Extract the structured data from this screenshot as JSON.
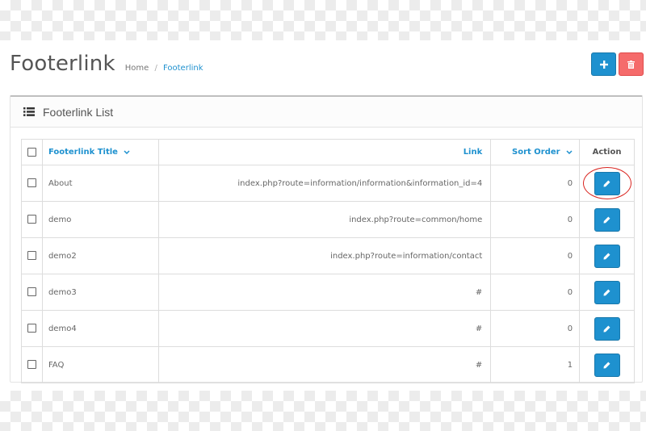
{
  "header": {
    "title": "Footerlink",
    "breadcrumb": [
      {
        "label": "Home"
      },
      {
        "label": "Footerlink"
      }
    ],
    "breadcrumb_separator": "/",
    "add_button_icon": "plus-icon",
    "delete_button_icon": "trash-icon"
  },
  "panel": {
    "title": "Footerlink List",
    "icon": "list-icon"
  },
  "table": {
    "columns": {
      "title": "Footerlink Title",
      "link": "Link",
      "sort_order": "Sort Order",
      "action": "Action"
    },
    "rows": [
      {
        "title": "About",
        "link": "index.php?route=information/information&information_id=4",
        "sort_order": "0"
      },
      {
        "title": "demo",
        "link": "index.php?route=common/home",
        "sort_order": "0"
      },
      {
        "title": "demo2",
        "link": "index.php?route=information/contact",
        "sort_order": "0"
      },
      {
        "title": "demo3",
        "link": "#",
        "sort_order": "0"
      },
      {
        "title": "demo4",
        "link": "#",
        "sort_order": "0"
      },
      {
        "title": "FAQ",
        "link": "#",
        "sort_order": "1"
      }
    ],
    "edit_icon": "pencil-icon"
  },
  "colors": {
    "primary": "#1e91cf",
    "danger": "#f56b6b",
    "highlight": "#d9241f"
  }
}
